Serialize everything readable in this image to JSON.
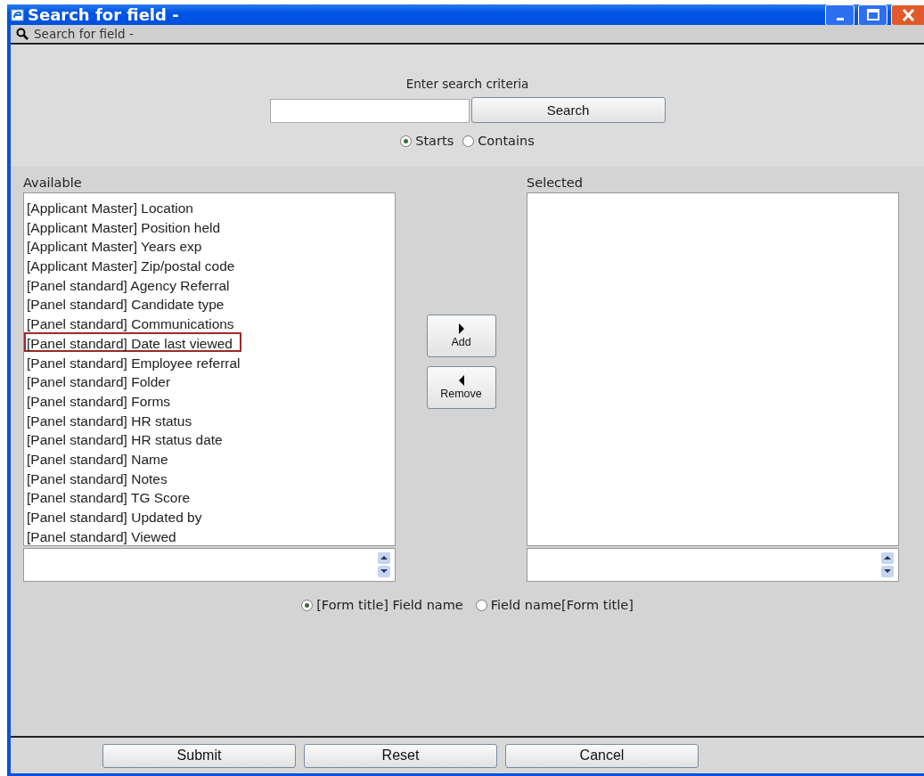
{
  "window": {
    "title": "Search for field -"
  },
  "header": {
    "label": "Search for field -"
  },
  "search": {
    "caption": "Enter search criteria",
    "button": "Search"
  },
  "match_options": [
    {
      "label": "Starts",
      "selected": true
    },
    {
      "label": "Contains",
      "selected": false
    }
  ],
  "available": {
    "label": "Available",
    "items": [
      {
        "text": "[Applicant Master] Location",
        "highlighted": false
      },
      {
        "text": "[Applicant Master] Position held",
        "highlighted": false
      },
      {
        "text": "[Applicant Master] Years exp",
        "highlighted": false
      },
      {
        "text": "[Applicant Master] Zip/postal code",
        "highlighted": false
      },
      {
        "text": "[Panel standard] Agency Referral",
        "highlighted": false
      },
      {
        "text": "[Panel standard] Candidate type",
        "highlighted": false
      },
      {
        "text": "[Panel standard] Communications",
        "highlighted": false
      },
      {
        "text": "[Panel standard] Date last viewed",
        "highlighted": true
      },
      {
        "text": "[Panel standard] Employee referral",
        "highlighted": false
      },
      {
        "text": "[Panel standard] Folder",
        "highlighted": false
      },
      {
        "text": "[Panel standard] Forms",
        "highlighted": false
      },
      {
        "text": "[Panel standard] HR status",
        "highlighted": false
      },
      {
        "text": "[Panel standard] HR status date",
        "highlighted": false
      },
      {
        "text": "[Panel standard] Name",
        "highlighted": false
      },
      {
        "text": "[Panel standard] Notes",
        "highlighted": false
      },
      {
        "text": "[Panel standard] TG Score",
        "highlighted": false
      },
      {
        "text": "[Panel standard] Updated by",
        "highlighted": false
      },
      {
        "text": "[Panel standard] Viewed",
        "highlighted": false
      }
    ]
  },
  "move_buttons": [
    {
      "kind": "right",
      "label": "Add"
    },
    {
      "kind": "left",
      "label": "Remove"
    }
  ],
  "selected": {
    "label": "Selected"
  },
  "display_options": [
    {
      "label": "[Form title] Field name",
      "selected": true
    },
    {
      "label": "Field name[Form title]",
      "selected": false
    }
  ],
  "buttons": [
    "Submit",
    "Reset",
    "Cancel"
  ]
}
